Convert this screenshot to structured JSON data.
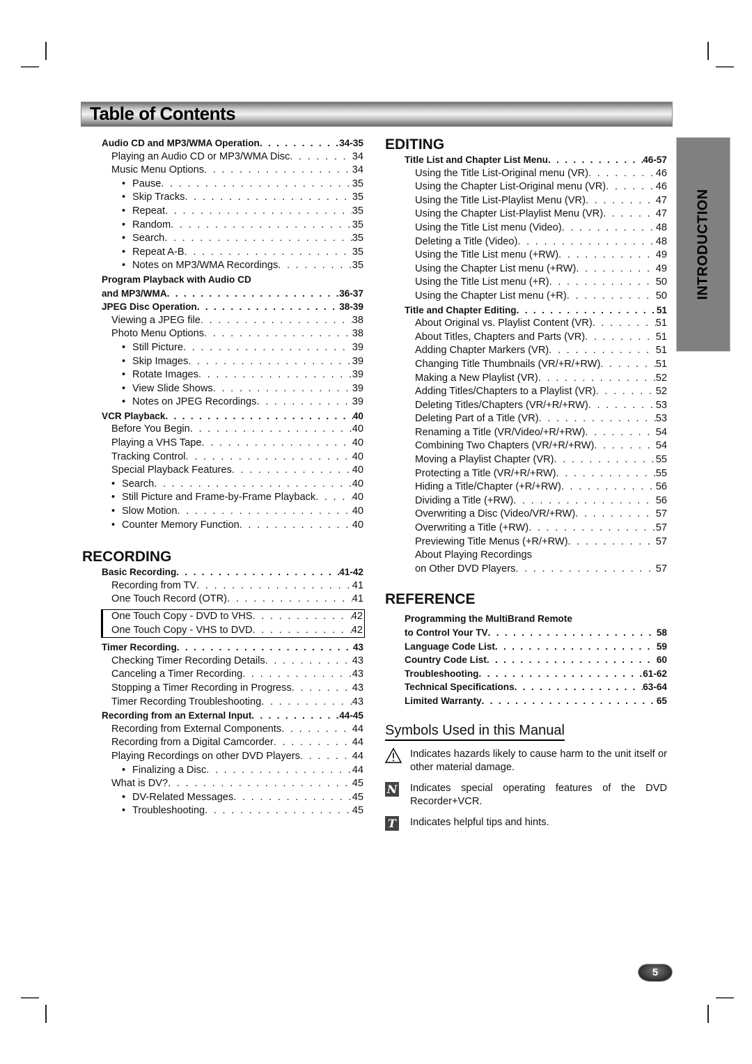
{
  "header": {
    "title": "Table of Contents"
  },
  "side_tab": {
    "label": "INTRODUCTION"
  },
  "page_number": "5",
  "left_column": {
    "intro_entries": [
      {
        "label": "Audio CD and MP3/WMA Operation",
        "page": "34-35",
        "level": 0
      },
      {
        "label": "Playing an Audio CD or MP3/WMA Disc",
        "page": "34",
        "level": 1
      },
      {
        "label": "Music Menu Options",
        "page": "34",
        "level": 1
      },
      {
        "label": "Pause",
        "page": "35",
        "level": 2
      },
      {
        "label": "Skip Tracks",
        "page": "35",
        "level": 2
      },
      {
        "label": "Repeat",
        "page": "35",
        "level": 2
      },
      {
        "label": "Random",
        "page": "35",
        "level": 2
      },
      {
        "label": "Search",
        "page": "35",
        "level": 2
      },
      {
        "label": "Repeat A-B",
        "page": "35",
        "level": 2
      },
      {
        "label": "Notes on MP3/WMA Recordings",
        "page": "35",
        "level": 2
      },
      {
        "label": "Program Playback with Audio CD",
        "page": "",
        "level": 0
      },
      {
        "label": "and MP3/WMA",
        "page": "36-37",
        "level": 0
      },
      {
        "label": "JPEG Disc Operation",
        "page": "38-39",
        "level": 0
      },
      {
        "label": "Viewing a JPEG file",
        "page": "38",
        "level": 1
      },
      {
        "label": "Photo Menu Options",
        "page": "38",
        "level": 1
      },
      {
        "label": "Still Picture",
        "page": "39",
        "level": 2
      },
      {
        "label": "Skip Images",
        "page": "39",
        "level": 2
      },
      {
        "label": "Rotate Images",
        "page": "39",
        "level": 2
      },
      {
        "label": "View Slide Shows",
        "page": "39",
        "level": 2
      },
      {
        "label": "Notes on JPEG Recordings",
        "page": "39",
        "level": 2
      },
      {
        "label": "VCR Playback",
        "page": "40",
        "level": 0
      },
      {
        "label": "Before You Begin",
        "page": "40",
        "level": 1
      },
      {
        "label": "Playing a VHS Tape",
        "page": "40",
        "level": 1
      },
      {
        "label": "Tracking Control",
        "page": "40",
        "level": 1
      },
      {
        "label": "Special Playback Features",
        "page": "40",
        "level": 1
      },
      {
        "label": "Search",
        "page": "40",
        "level": 3
      },
      {
        "label": "Still Picture and Frame-by-Frame Playback",
        "page": "40",
        "level": 3
      },
      {
        "label": "Slow Motion",
        "page": "40",
        "level": 3
      },
      {
        "label": "Counter Memory Function",
        "page": "40",
        "level": 3
      }
    ],
    "recording": {
      "title": "RECORDING",
      "basic": [
        {
          "label": "Basic Recording",
          "page": "41-42",
          "level": 0
        },
        {
          "label": "Recording from TV",
          "page": "41",
          "level": 1
        },
        {
          "label": "One Touch Record (OTR)",
          "page": "41",
          "level": 1
        }
      ],
      "boxed": [
        {
          "label": "One Touch Copy - DVD to VHS",
          "page": "42"
        },
        {
          "label": "One Touch Copy - VHS to DVD",
          "page": "42"
        }
      ],
      "rest": [
        {
          "label": "Timer Recording",
          "page": "43",
          "level": 0
        },
        {
          "label": "Checking Timer Recording Details",
          "page": "43",
          "level": 1
        },
        {
          "label": "Canceling a Timer Recording",
          "page": "43",
          "level": 1
        },
        {
          "label": "Stopping a Timer Recording in Progress",
          "page": "43",
          "level": 1
        },
        {
          "label": "Timer Recording Troubleshooting",
          "page": "43",
          "level": 1
        },
        {
          "label": "Recording from an External Input",
          "page": "44-45",
          "level": 0
        },
        {
          "label": "Recording from External Components",
          "page": "44",
          "level": 1
        },
        {
          "label": "Recording from a Digital Camcorder",
          "page": "44",
          "level": 1
        },
        {
          "label": "Playing Recordings on other DVD Players",
          "page": "44",
          "level": 1
        },
        {
          "label": "Finalizing a Disc",
          "page": "44",
          "level": 2
        },
        {
          "label": "What is DV?",
          "page": "45",
          "level": 1
        },
        {
          "label": "DV-Related Messages",
          "page": "45",
          "level": 2
        },
        {
          "label": "Troubleshooting",
          "page": "45",
          "level": 2
        }
      ]
    }
  },
  "right_column": {
    "editing": {
      "title": "EDITING",
      "entries": [
        {
          "label": "Title List and Chapter List Menu",
          "page": "46-57",
          "level": 0
        },
        {
          "label": "Using the Title List-Original menu (VR)",
          "page": "46",
          "level": 1
        },
        {
          "label": "Using the Chapter List-Original menu (VR)",
          "page": "46",
          "level": 1
        },
        {
          "label": "Using the Title List-Playlist Menu (VR)",
          "page": "47",
          "level": 1
        },
        {
          "label": "Using the Chapter List-Playlist Menu (VR)",
          "page": "47",
          "level": 1
        },
        {
          "label": "Using the Title List menu (Video)",
          "page": "48",
          "level": 1
        },
        {
          "label": "Deleting a Title (Video)",
          "page": "48",
          "level": 1
        },
        {
          "label": "Using the Title List menu (+RW)",
          "page": "49",
          "level": 1
        },
        {
          "label": "Using the Chapter List menu (+RW)",
          "page": "49",
          "level": 1
        },
        {
          "label": "Using the Title List menu (+R)",
          "page": "50",
          "level": 1
        },
        {
          "label": "Using the Chapter List menu (+R)",
          "page": "50",
          "level": 1
        },
        {
          "label": "Title and Chapter Editing",
          "page": "51",
          "level": 0
        },
        {
          "label": "About Original vs. Playlist Content (VR)",
          "page": "51",
          "level": 1
        },
        {
          "label": "About Titles, Chapters and Parts (VR)",
          "page": "51",
          "level": 1
        },
        {
          "label": "Adding Chapter Markers (VR)",
          "page": "51",
          "level": 1
        },
        {
          "label": "Changing Title Thumbnails (VR/+R/+RW)",
          "page": "51",
          "level": 1
        },
        {
          "label": "Making a New Playlist (VR)",
          "page": "52",
          "level": 1
        },
        {
          "label": "Adding Titles/Chapters to a Playlist (VR)",
          "page": "52",
          "level": 1
        },
        {
          "label": "Deleting Titles/Chapters (VR/+R/+RW)",
          "page": "53",
          "level": 1
        },
        {
          "label": "Deleting Part of a Title (VR)",
          "page": "53",
          "level": 1
        },
        {
          "label": "Renaming a Title (VR/Video/+R/+RW)",
          "page": "54",
          "level": 1
        },
        {
          "label": "Combining Two Chapters (VR/+R/+RW)",
          "page": "54",
          "level": 1
        },
        {
          "label": "Moving a Playlist Chapter (VR)",
          "page": "55",
          "level": 1
        },
        {
          "label": "Protecting a Title (VR/+R/+RW)",
          "page": "55",
          "level": 1
        },
        {
          "label": "Hiding a Title/Chapter (+R/+RW)",
          "page": "56",
          "level": 1
        },
        {
          "label": "Dividing a Title (+RW)",
          "page": "56",
          "level": 1
        },
        {
          "label": "Overwriting a Disc (Video/VR/+RW)",
          "page": "57",
          "level": 1
        },
        {
          "label": "Overwriting a Title (+RW)",
          "page": "57",
          "level": 1
        },
        {
          "label": "Previewing Title Menus (+R/+RW)",
          "page": "57",
          "level": 1
        },
        {
          "label": "About Playing Recordings",
          "page": "",
          "level": 1
        },
        {
          "label": "on Other DVD Players",
          "page": "57",
          "level": 1
        }
      ]
    },
    "reference": {
      "title": "REFERENCE",
      "entries": [
        {
          "label": "Programming the MultiBrand Remote",
          "page": "",
          "level": 0
        },
        {
          "label": "to Control Your TV",
          "page": "58",
          "level": 0
        },
        {
          "label": "Language Code List",
          "page": "59",
          "level": 0
        },
        {
          "label": "Country Code List",
          "page": "60",
          "level": 0
        },
        {
          "label": "Troubleshooting",
          "page": "61-62",
          "level": 0
        },
        {
          "label": "Technical Specifications",
          "page": "63-64",
          "level": 0
        },
        {
          "label": "Limited Warranty",
          "page": "65",
          "level": 0
        }
      ]
    },
    "symbols": {
      "title": "Symbols Used in this Manual",
      "items": [
        {
          "icon": "warning-triangle-icon",
          "glyph": "⚠",
          "text": "Indicates hazards likely to cause harm to the unit itself or other material damage."
        },
        {
          "icon": "note-icon",
          "glyph": "N",
          "text": "Indicates special operating features of the DVD Recorder+VCR."
        },
        {
          "icon": "tip-icon",
          "glyph": "T",
          "text": "Indicates helpful tips and hints."
        }
      ]
    }
  }
}
